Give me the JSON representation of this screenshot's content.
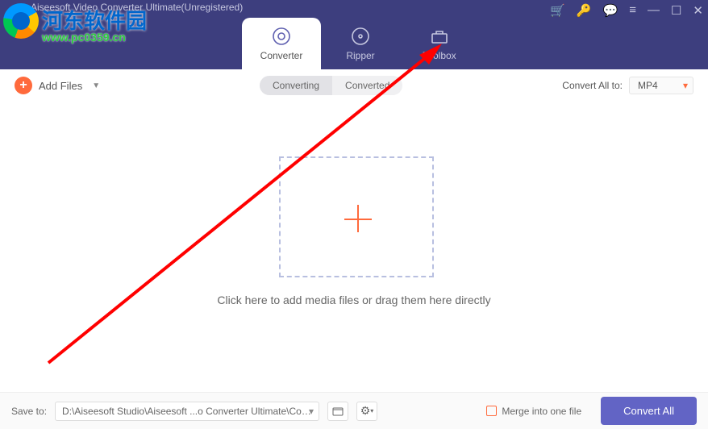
{
  "app_title": "Aiseesoft Video Converter Ultimate(Unregistered)",
  "tabs": {
    "converter": "Converter",
    "ripper": "Ripper",
    "toolbox": "Toolbox"
  },
  "toolbar": {
    "add_files": "Add Files",
    "seg_converting": "Converting",
    "seg_converted": "Converted",
    "convert_all_to_label": "Convert All to:",
    "convert_all_to_value": "MP4"
  },
  "main": {
    "drop_hint": "Click here to add media files or drag them here directly"
  },
  "footer": {
    "save_to_label": "Save to:",
    "save_to_path": "D:\\Aiseesoft Studio\\Aiseesoft ...o Converter Ultimate\\Converted",
    "merge_label": "Merge into one file",
    "convert_all_btn": "Convert All"
  },
  "watermark": {
    "site_name": "河东软件园",
    "site_url": "www.pc0359.cn"
  }
}
